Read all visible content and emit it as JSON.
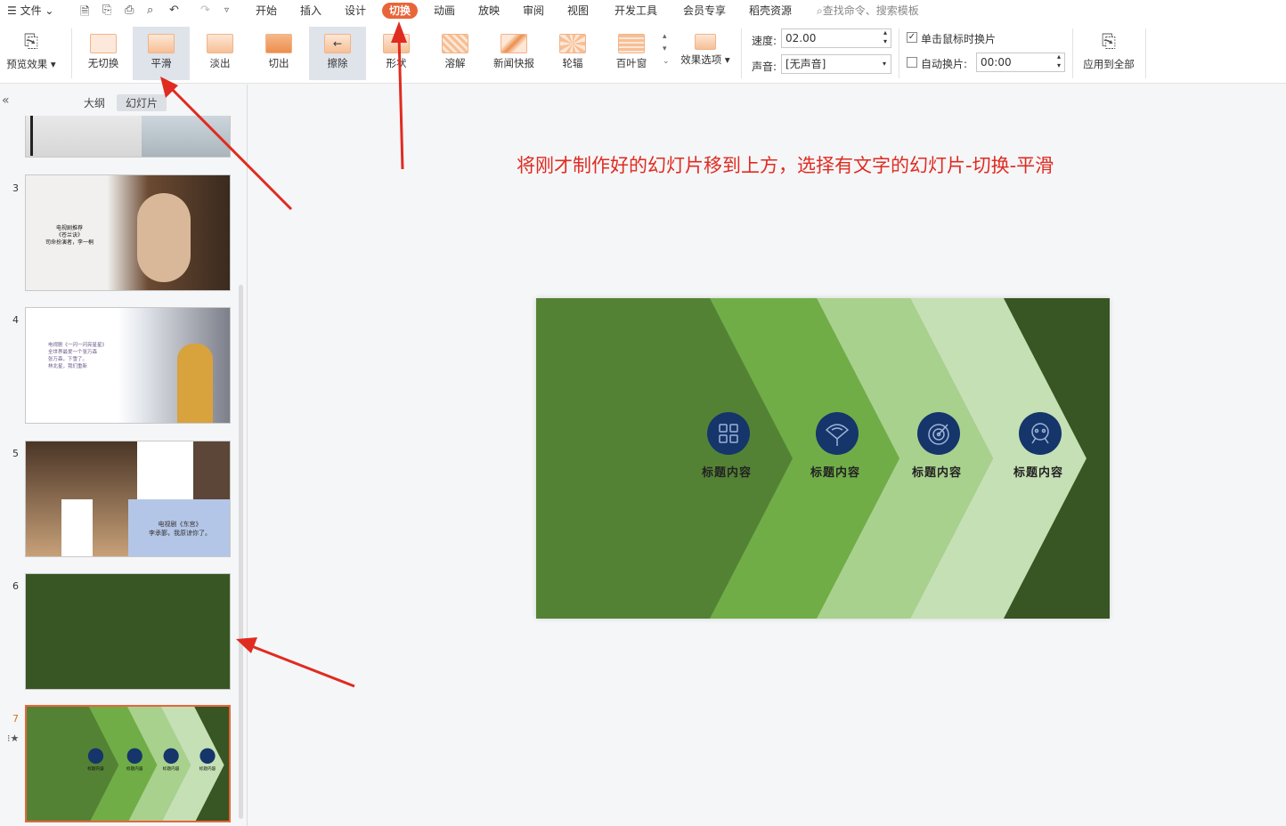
{
  "menu": {
    "file": "文件",
    "tabs": [
      "开始",
      "插入",
      "设计",
      "切换",
      "动画",
      "放映",
      "审阅",
      "视图",
      "开发工具",
      "会员专享",
      "稻壳资源"
    ],
    "active_tab": "切换",
    "search_placeholder": "查找命令、搜索模板"
  },
  "ribbon": {
    "preview": "预览效果",
    "transitions": [
      "无切换",
      "平滑",
      "淡出",
      "切出",
      "擦除",
      "形状",
      "溶解",
      "新闻快报",
      "轮辐",
      "百叶窗"
    ],
    "selected_transition": "平滑",
    "effect_options": "效果选项",
    "speed_label": "速度:",
    "speed_value": "02.00",
    "sound_label": "声音:",
    "sound_value": "[无声音]",
    "click_switch": "单击鼠标时换片",
    "click_switch_checked": true,
    "auto_switch": "自动换片:",
    "auto_value": "00:00",
    "auto_checked": false,
    "apply_all": "应用到全部"
  },
  "panel": {
    "tab_outline": "大纲",
    "tab_slides": "幻灯片",
    "active_tab": "幻灯片",
    "slides": [
      {
        "num": "3",
        "line1": "电视剧推荐",
        "line2": "《苍兰诀》",
        "line3": "司命扮演者，李一桐"
      },
      {
        "num": "4",
        "line1": "电视剧《一闪一闪亮星星》",
        "line2": "全世界最爱一个张万森",
        "line3": "张万森，下雪了。",
        "line4": "林北星，我们重新"
      },
      {
        "num": "5",
        "line1": "电视剧《东宫》",
        "line2": "李承鄞，我原谅你了。"
      },
      {
        "num": "6"
      },
      {
        "num": "7"
      }
    ]
  },
  "slide": {
    "items": [
      {
        "title": "标题内容",
        "icon": "grid-chart-icon"
      },
      {
        "title": "标题内容",
        "icon": "fan-icon"
      },
      {
        "title": "标题内容",
        "icon": "target-icon"
      },
      {
        "title": "标题内容",
        "icon": "robot-icon"
      }
    ],
    "colors": {
      "dark": "#548235",
      "mid": "#70ad47",
      "light": "#a9d18e",
      "pale": "#c5e0b4",
      "deep": "#375623",
      "circle": "#15356b"
    }
  },
  "instruction": "将刚才制作好的幻灯片移到上方，选择有文字的幻灯片-切换-平滑"
}
